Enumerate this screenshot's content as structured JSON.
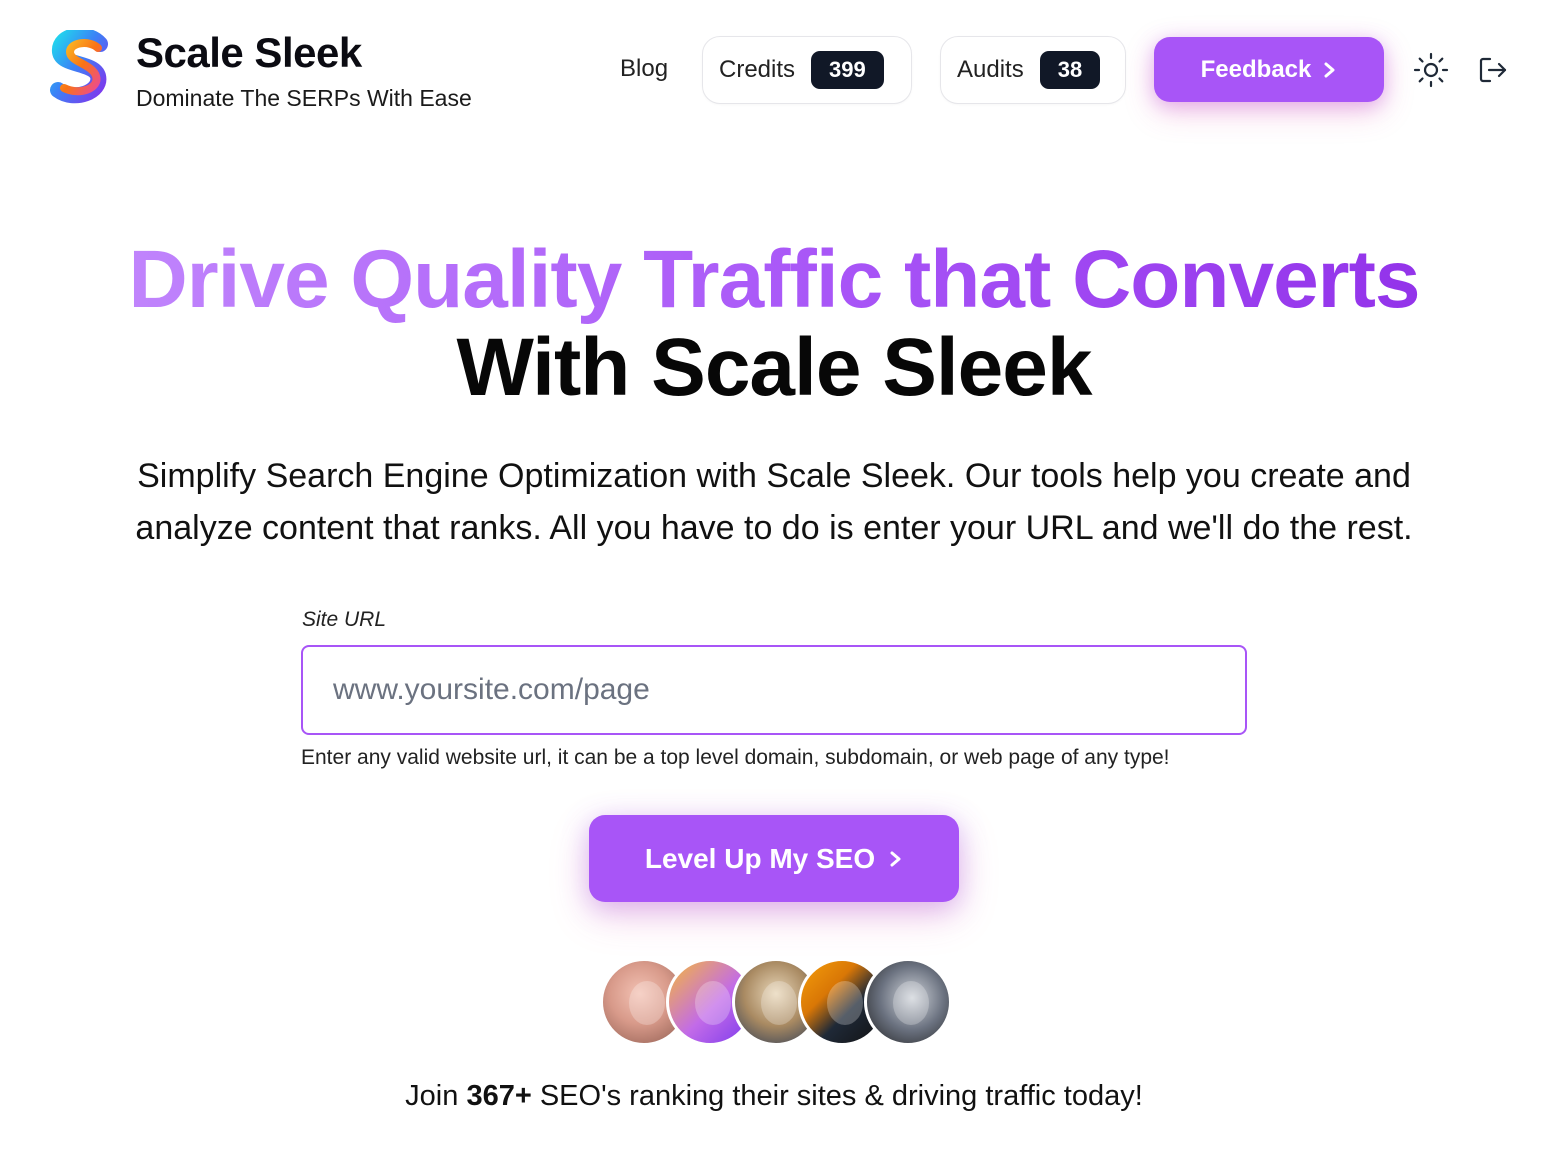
{
  "header": {
    "brand_name": "Scale Sleek",
    "brand_tagline": "Dominate The SERPs With Ease",
    "nav_blog": "Blog",
    "credits_label": "Credits",
    "credits_count": "399",
    "audits_label": "Audits",
    "audits_count": "38",
    "feedback_label": "Feedback"
  },
  "hero": {
    "headline_line1": "Drive Quality Traffic that Converts",
    "headline_line2": "With Scale Sleek",
    "subheadline": "Simplify Search Engine Optimization with Scale Sleek. Our tools help you create and analyze content that ranks. All you have to do is enter your URL and we'll do the rest."
  },
  "form": {
    "field_label": "Site URL",
    "url_placeholder": "www.yoursite.com/page",
    "url_value": "",
    "help_text": "Enter any valid website url, it can be a top level domain, subdomain, or web page of any type!",
    "cta_label": "Level Up My SEO"
  },
  "social_proof": {
    "prefix": "Join ",
    "count": "367+",
    "suffix": " SEO's ranking their sites & driving traffic today!"
  },
  "colors": {
    "accent": "#a855f7",
    "accent_light": "#c084fc",
    "badge_bg": "#111827"
  },
  "icons": {
    "theme_toggle": "sun-icon",
    "logout": "logout-icon",
    "chevron": "chevron-right-icon"
  }
}
